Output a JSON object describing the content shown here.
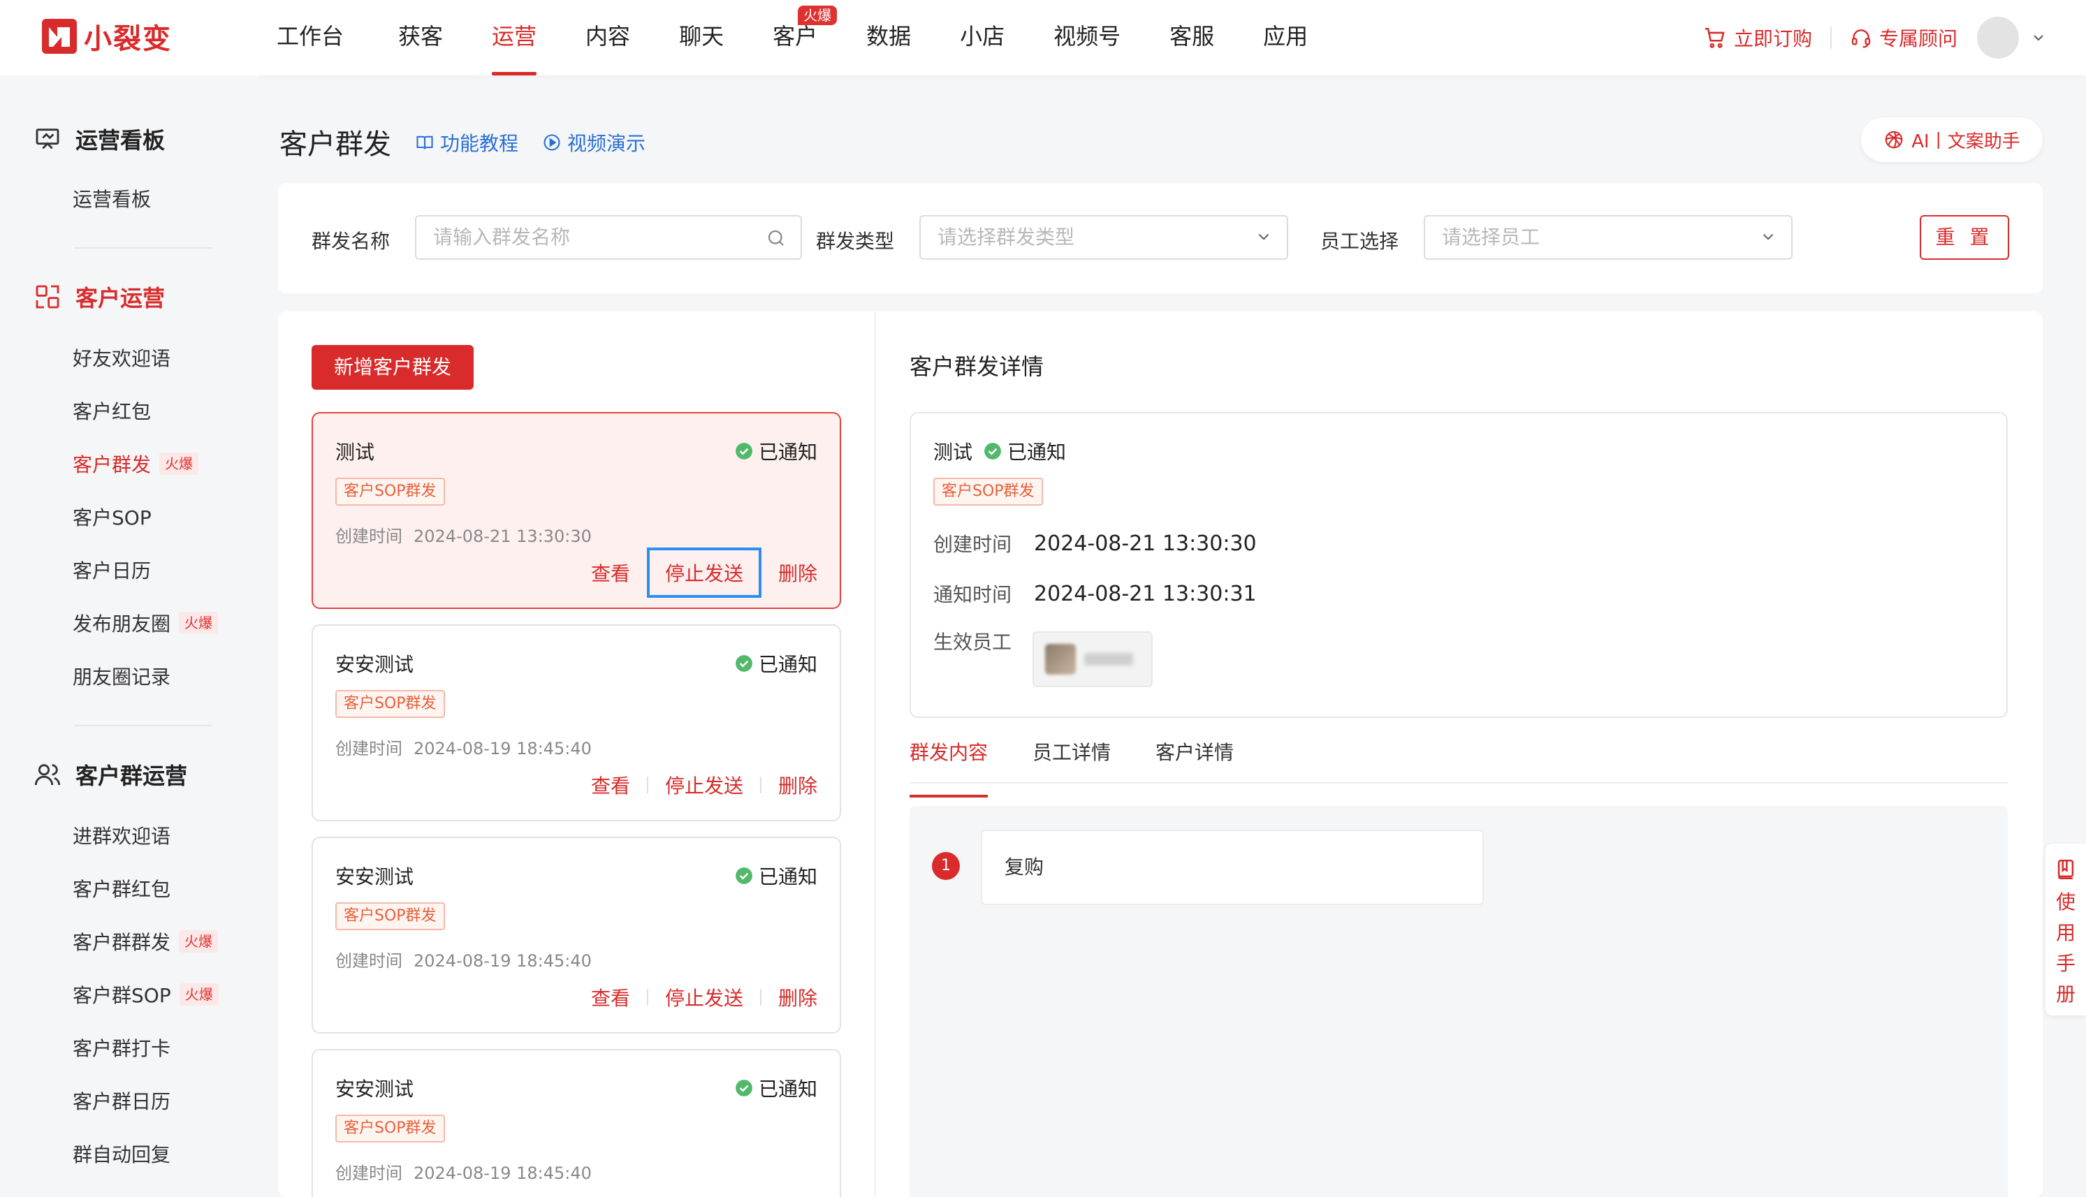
{
  "brand": {
    "name": "小裂变",
    "color": "#d92b2b"
  },
  "nav": {
    "items": [
      {
        "label": "工作台"
      },
      {
        "label": "获客"
      },
      {
        "label": "运营",
        "active": true
      },
      {
        "label": "内容"
      },
      {
        "label": "聊天"
      },
      {
        "label": "客户",
        "badge": "火爆"
      },
      {
        "label": "数据"
      },
      {
        "label": "小店"
      },
      {
        "label": "视频号"
      },
      {
        "label": "客服"
      },
      {
        "label": "应用"
      }
    ],
    "order_label": "立即订购",
    "advisor_label": "专属顾问"
  },
  "sidebar": {
    "groups": [
      {
        "title": "运营看板",
        "items": [
          {
            "label": "运营看板"
          }
        ]
      },
      {
        "title": "客户运营",
        "items": [
          {
            "label": "好友欢迎语"
          },
          {
            "label": "客户红包"
          },
          {
            "label": "客户群发",
            "hot": "火爆",
            "active": true
          },
          {
            "label": "客户SOP"
          },
          {
            "label": "客户日历"
          },
          {
            "label": "发布朋友圈",
            "hot": "火爆"
          },
          {
            "label": "朋友圈记录"
          }
        ]
      },
      {
        "title": "客户群运营",
        "items": [
          {
            "label": "进群欢迎语"
          },
          {
            "label": "客户群红包"
          },
          {
            "label": "客户群群发",
            "hot": "火爆"
          },
          {
            "label": "客户群SOP",
            "hot": "火爆"
          },
          {
            "label": "客户群打卡"
          },
          {
            "label": "客户群日历"
          },
          {
            "label": "群自动回复"
          }
        ]
      }
    ]
  },
  "page": {
    "title": "客户群发",
    "tutorial_label": "功能教程",
    "video_label": "视频演示",
    "ai_label": "AI丨文案助手"
  },
  "filters": {
    "name_label": "群发名称",
    "name_placeholder": "请输入群发名称",
    "type_label": "群发类型",
    "type_placeholder": "请选择群发类型",
    "staff_label": "员工选择",
    "staff_placeholder": "请选择员工",
    "reset_label": "重 置"
  },
  "list": {
    "add_label": "新增客户群发",
    "time_prefix": "创建时间",
    "actions": {
      "view": "查看",
      "stop": "停止发送",
      "delete": "删除"
    },
    "cards": [
      {
        "title": "测试",
        "status": "已通知",
        "tag": "客户SOP群发",
        "time": "2024-08-21 13:30:30",
        "selected": true
      },
      {
        "title": "安安测试",
        "status": "已通知",
        "tag": "客户SOP群发",
        "time": "2024-08-19 18:45:40"
      },
      {
        "title": "安安测试",
        "status": "已通知",
        "tag": "客户SOP群发",
        "time": "2024-08-19 18:45:40"
      },
      {
        "title": "安安测试",
        "status": "已通知",
        "tag": "客户SOP群发",
        "time": "2024-08-19 18:45:40"
      }
    ]
  },
  "detail": {
    "title": "客户群发详情",
    "name": "测试",
    "status": "已通知",
    "tag": "客户SOP群发",
    "created_label": "创建时间",
    "created_value": "2024-08-21 13:30:30",
    "notified_label": "通知时间",
    "notified_value": "2024-08-21 13:30:31",
    "staff_label": "生效员工",
    "tabs": [
      {
        "label": "群发内容",
        "active": true
      },
      {
        "label": "员工详情"
      },
      {
        "label": "客户详情"
      }
    ],
    "messages": [
      {
        "index": "1",
        "text": "复购"
      }
    ]
  },
  "manual_label": "使用手册",
  "colors": {
    "accent": "#d92b2b",
    "success": "#52b96a",
    "link": "#2b6fd6",
    "highlight": "#2a8ff0"
  }
}
